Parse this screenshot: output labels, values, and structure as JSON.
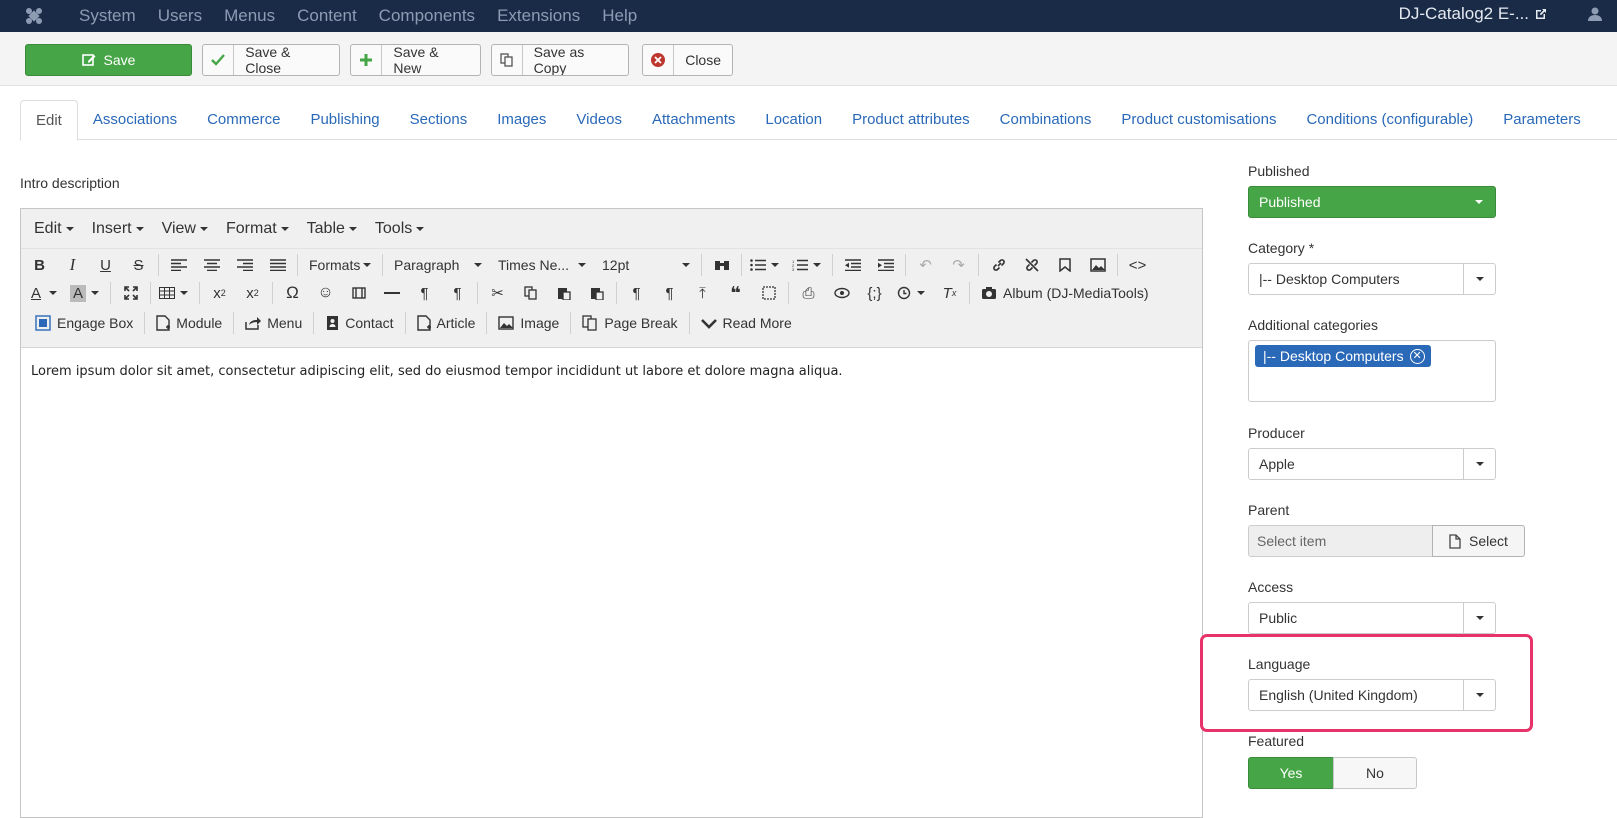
{
  "topbar": {
    "menu": [
      "System",
      "Users",
      "Menus",
      "Content",
      "Components",
      "Extensions",
      "Help"
    ],
    "site_name": "DJ-Catalog2 E-...",
    "icons": [
      "joomla-logo-icon",
      "external-link-icon",
      "user-icon"
    ]
  },
  "toolbar": {
    "save": "Save",
    "save_close": "Save & Close",
    "save_new": "Save & New",
    "save_copy": "Save as Copy",
    "close": "Close"
  },
  "tabs": [
    "Edit",
    "Associations",
    "Commerce",
    "Publishing",
    "Sections",
    "Images",
    "Videos",
    "Attachments",
    "Location",
    "Product attributes",
    "Combinations",
    "Product customisations",
    "Conditions (configurable)",
    "Parameters"
  ],
  "editor": {
    "label": "Intro description",
    "menus": [
      "Edit",
      "Insert",
      "View",
      "Format",
      "Table",
      "Tools"
    ],
    "formats": "Formats",
    "block": "Paragraph",
    "font": "Times Ne...",
    "size": "12pt",
    "album": "Album (DJ-MediaTools)",
    "buttons": [
      "Engage Box",
      "Module",
      "Menu",
      "Contact",
      "Article",
      "Image",
      "Page Break",
      "Read More"
    ],
    "content": "Lorem ipsum dolor sit amet, consectetur adipiscing elit, sed do eiusmod tempor incididunt ut labore et dolore magna aliqua."
  },
  "sidebar": {
    "published_label": "Published",
    "published_value": "Published",
    "category_label": "Category *",
    "category_value": "|-- Desktop Computers",
    "additional_label": "Additional categories",
    "additional_chip": "|-- Desktop Computers",
    "producer_label": "Producer",
    "producer_value": "Apple",
    "parent_label": "Parent",
    "parent_placeholder": "Select item",
    "parent_button": "Select",
    "access_label": "Access",
    "access_value": "Public",
    "language_label": "Language",
    "language_value": "English (United Kingdom)",
    "featured_label": "Featured",
    "featured_yes": "Yes",
    "featured_no": "No"
  },
  "colors": {
    "green": "#46a546",
    "blue": "#2a69b8",
    "navy": "#1a2b47",
    "highlight": "#e8336a"
  }
}
